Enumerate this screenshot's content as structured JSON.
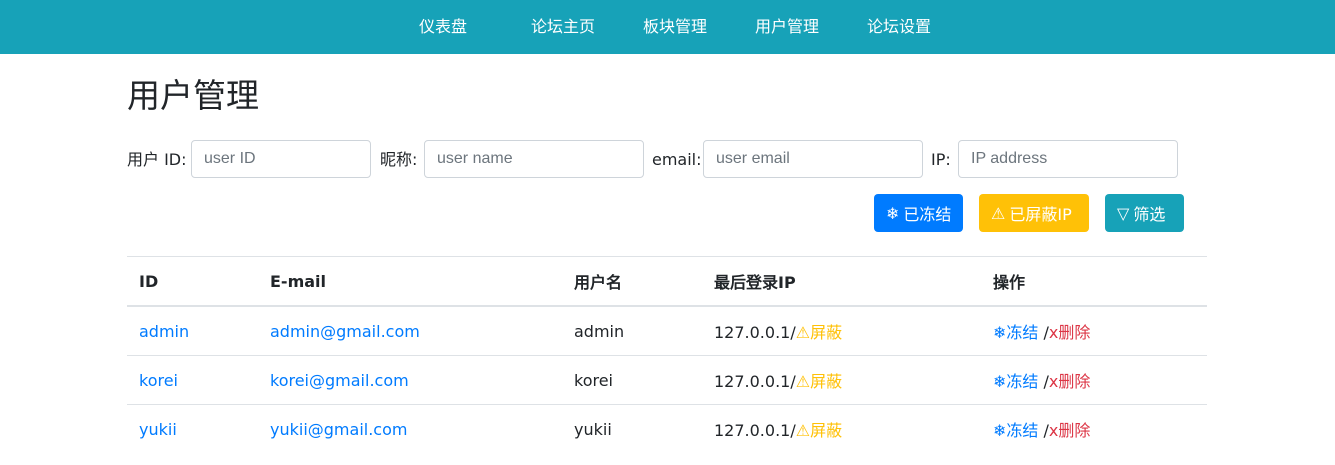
{
  "nav": {
    "items": [
      "仪表盘",
      "论坛主页",
      "板块管理",
      "用户管理",
      "论坛设置"
    ]
  },
  "page": {
    "title": "用户管理"
  },
  "filters": {
    "user_id": {
      "label": "用户 ID:",
      "placeholder": "user ID",
      "value": ""
    },
    "nickname": {
      "label": "昵称:",
      "placeholder": "user name",
      "value": ""
    },
    "email": {
      "label": "email:",
      "placeholder": "user email",
      "value": ""
    },
    "ip": {
      "label": "IP:",
      "placeholder": "IP address",
      "value": ""
    }
  },
  "buttons": {
    "frozen": {
      "icon": "❄",
      "label": "已冻结"
    },
    "blocked_ip": {
      "icon": "⚠",
      "label": "已屏蔽IP"
    },
    "filter": {
      "icon": "▽",
      "label": "筛选"
    }
  },
  "table": {
    "columns": [
      "ID",
      "E-mail",
      "用户名",
      "最后登录IP",
      "操作"
    ],
    "rows": [
      {
        "id": "admin",
        "email": "admin@gmail.com",
        "username": "admin",
        "ip": "127.0.0.1/",
        "block": "⚠屏蔽",
        "freeze": "❄冻结",
        "sep": " /",
        "delete": "x删除"
      },
      {
        "id": "korei",
        "email": "korei@gmail.com",
        "username": "korei",
        "ip": "127.0.0.1/",
        "block": "⚠屏蔽",
        "freeze": "❄冻结",
        "sep": " /",
        "delete": "x删除"
      },
      {
        "id": "yukii",
        "email": "yukii@gmail.com",
        "username": "yukii",
        "ip": "127.0.0.1/",
        "block": "⚠屏蔽",
        "freeze": "❄冻结",
        "sep": " /",
        "delete": "x删除"
      }
    ]
  },
  "colors": {
    "nav_bg": "#17a2b8",
    "primary": "#007bff",
    "warning": "#ffc107",
    "danger": "#dc3545"
  }
}
